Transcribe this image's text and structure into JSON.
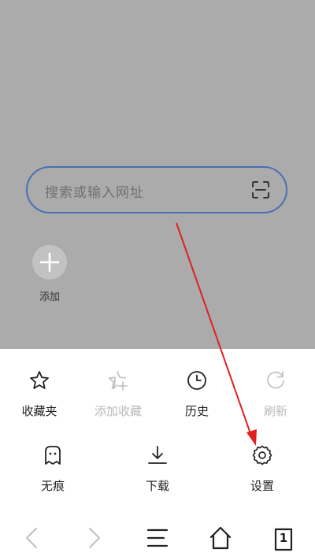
{
  "search": {
    "placeholder": "搜索或输入网址"
  },
  "shortcuts": {
    "add_label": "添加"
  },
  "menu": {
    "row1": [
      {
        "label": "收藏夹",
        "icon": "star-icon",
        "enabled": true
      },
      {
        "label": "添加收藏",
        "icon": "star-plus-icon",
        "enabled": false
      },
      {
        "label": "历史",
        "icon": "clock-icon",
        "enabled": true
      },
      {
        "label": "刷新",
        "icon": "refresh-icon",
        "enabled": false
      }
    ],
    "row2": [
      {
        "label": "无痕",
        "icon": "ghost-icon",
        "enabled": true
      },
      {
        "label": "下载",
        "icon": "download-icon",
        "enabled": true
      },
      {
        "label": "设置",
        "icon": "gear-icon",
        "enabled": true
      }
    ]
  },
  "bottom_nav": {
    "tab_count": "1"
  },
  "colors": {
    "overlay": "#ababab",
    "search_border": "#4a6fb5",
    "annotation_arrow": "#e02020",
    "disabled_text": "#b9b9b9"
  }
}
